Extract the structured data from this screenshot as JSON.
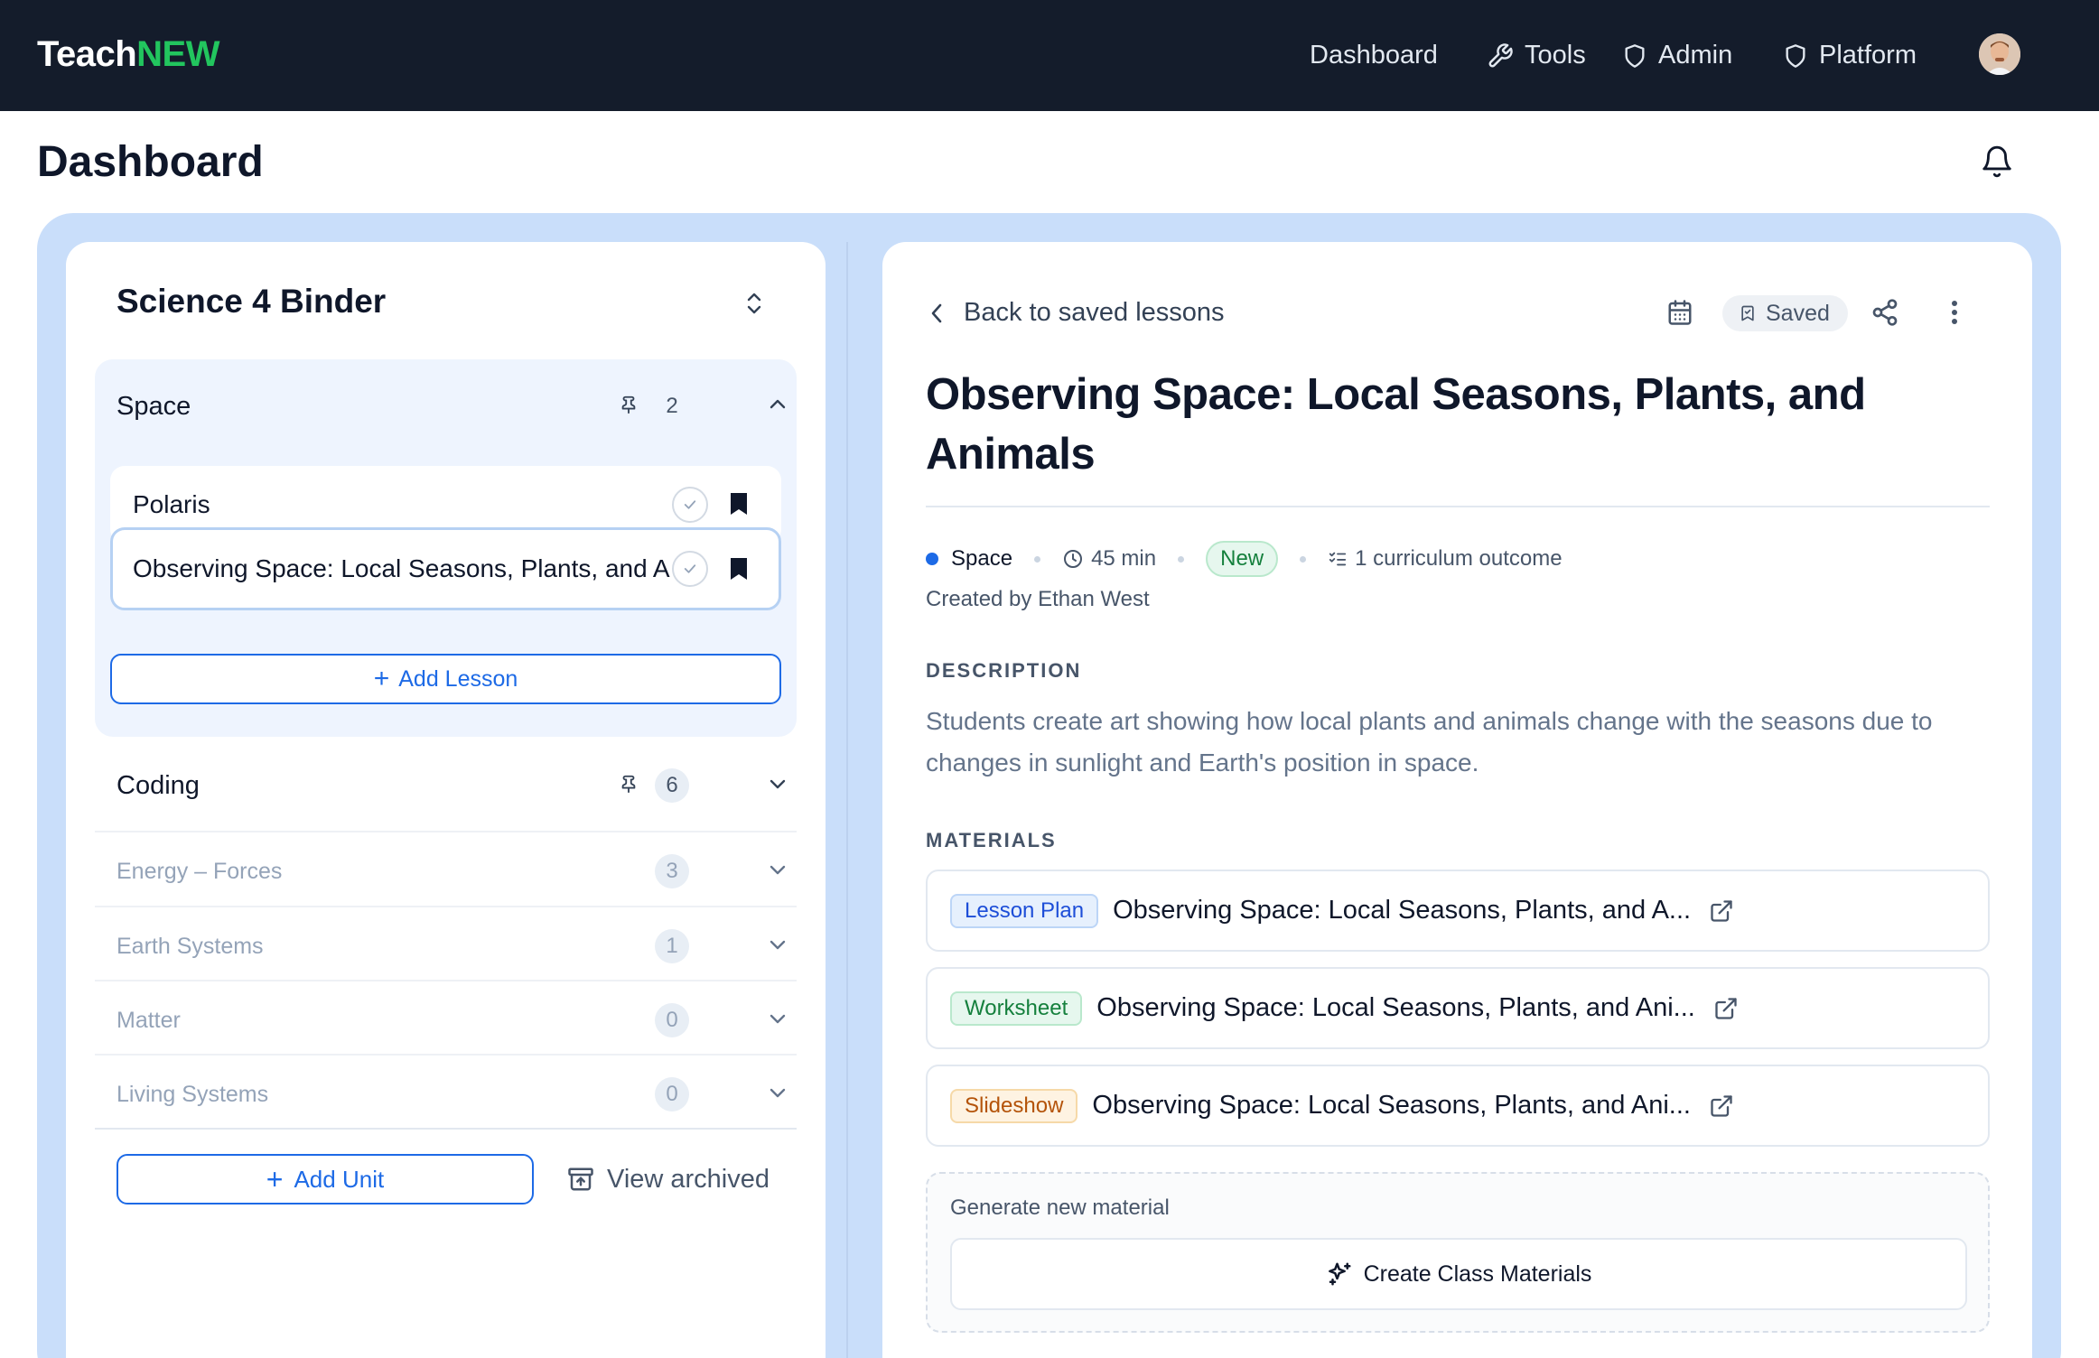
{
  "app": {
    "brand_part1": "Teach",
    "brand_part2": "NEW",
    "accent_color": "#22c55e",
    "header_bg": "#141c2b"
  },
  "nav": {
    "dashboard": "Dashboard",
    "tools": "Tools",
    "admin": "Admin",
    "platform": "Platform"
  },
  "page": {
    "title": "Dashboard"
  },
  "binder": {
    "title": "Science 4 Binder",
    "units": [
      {
        "name": "Space",
        "count": "2",
        "expanded": true,
        "lessons": [
          {
            "title": "Polaris"
          },
          {
            "title": "Observing Space: Local Seasons, Plants, and Animals"
          }
        ],
        "add_lesson_label": "Add Lesson"
      },
      {
        "name": "Coding",
        "count": "6"
      },
      {
        "name": "Energy – Forces",
        "count": "3"
      },
      {
        "name": "Earth Systems",
        "count": "1"
      },
      {
        "name": "Matter",
        "count": "0"
      },
      {
        "name": "Living Systems",
        "count": "0"
      }
    ],
    "add_unit_label": "Add Unit",
    "view_archived_label": "View archived"
  },
  "lesson": {
    "back_label": "Back to saved lessons",
    "saved_label": "Saved",
    "title": "Observing Space: Local Seasons, Plants, and Animals",
    "unit": "Space",
    "duration": "45 min",
    "new_badge": "New",
    "outcomes": "1 curriculum outcome",
    "created_by": "Created by Ethan West",
    "description_label": "DESCRIPTION",
    "description": "Students create art showing how local plants and animals change with the seasons due to changes in sunlight and Earth's position in space.",
    "materials_label": "MATERIALS",
    "materials": [
      {
        "type": "Lesson Plan",
        "title": "Observing Space: Local Seasons, Plants, and A..."
      },
      {
        "type": "Worksheet",
        "title": "Observing Space: Local Seasons, Plants, and Ani..."
      },
      {
        "type": "Slideshow",
        "title": "Observing Space: Local Seasons, Plants, and Ani..."
      }
    ],
    "generate_label": "Generate new material",
    "create_button_label": "Create Class Materials"
  }
}
